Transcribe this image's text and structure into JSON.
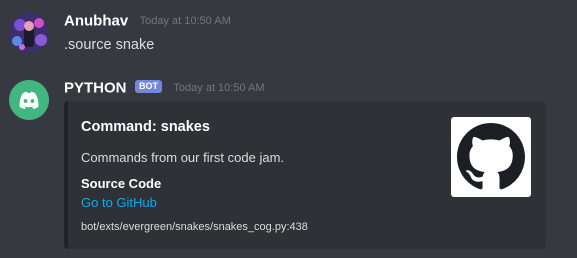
{
  "messages": [
    {
      "author": "Anubhav",
      "timestamp": "Today at 10:50 AM",
      "content": ".source snake",
      "avatar_icon": "user-avatar-icon"
    },
    {
      "author": "PYTHON",
      "bot_tag": "BOT",
      "timestamp": "Today at 10:50 AM",
      "avatar_icon": "discord-logo-icon",
      "avatar_color": "#43b581",
      "embed": {
        "title": "Command: snakes",
        "description": "Commands from our first code jam.",
        "field_name": "Source Code",
        "field_link": "Go to GitHub",
        "footer": "bot/exts/evergreen/snakes/snakes_cog.py:438",
        "thumbnail_icon": "github-logo-icon",
        "border_color": "#202225",
        "link_color": "#00b0f4"
      }
    }
  ]
}
